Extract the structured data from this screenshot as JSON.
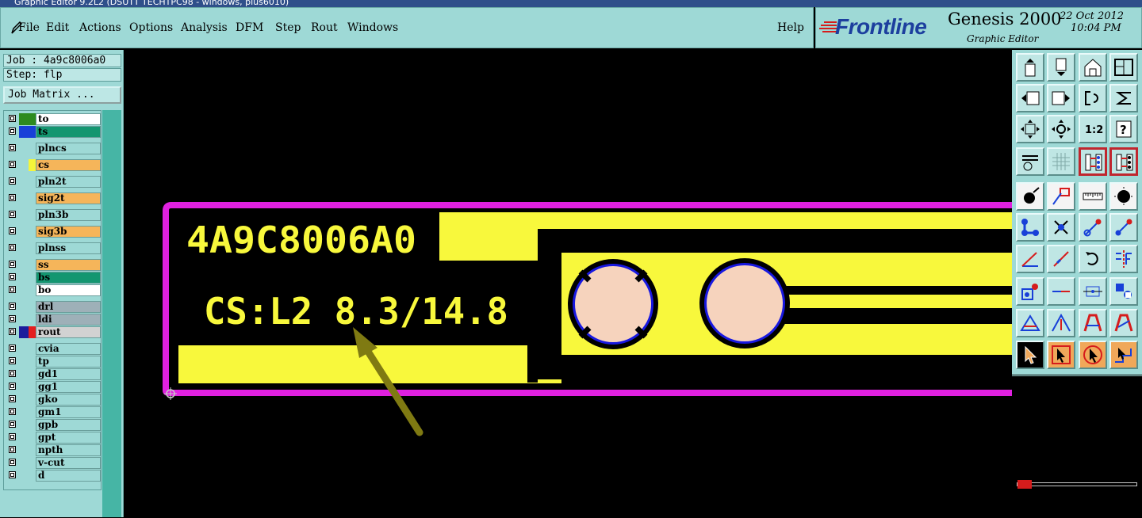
{
  "title_bar": "Graphic Editor 9.2L2 (DSUTT TECHTPC98 - windows, plus6010)",
  "menu": {
    "items": [
      {
        "label": "File"
      },
      {
        "label": "Edit"
      },
      {
        "label": "Actions"
      },
      {
        "label": "Options"
      },
      {
        "label": "Analysis"
      },
      {
        "label": "DFM"
      },
      {
        "label": "Step"
      },
      {
        "label": "Rout"
      },
      {
        "label": "Windows"
      }
    ],
    "help": "Help"
  },
  "brand": {
    "logo": "Frontline",
    "product": "Genesis 2000",
    "subtitle": "Graphic Editor",
    "date": "22 Oct 2012",
    "time": "10:04 PM"
  },
  "info": {
    "job": "Job : 4a9c8006a0",
    "step": "Step: flp",
    "job_matrix": "Job Matrix ..."
  },
  "layers": [
    {
      "name": "to",
      "sw1": "#2e8b1f",
      "sw2": "#2e8b1f",
      "bg": "#ffffff"
    },
    {
      "name": "ts",
      "sw1": "#1840d8",
      "sw2": "#1840d8",
      "bg": "#139670"
    },
    {
      "name": "plncs",
      "sw1": "#9ed9d6",
      "sw2": "#9ed9d6",
      "bg": "#9ed9d6"
    },
    {
      "name": "cs",
      "sw1": "#9ed9d6",
      "sw2": "#f5f53a",
      "bg": "#f5b55a"
    },
    {
      "name": "pln2t",
      "sw1": "#9ed9d6",
      "sw2": "#9ed9d6",
      "bg": "#9ed9d6"
    },
    {
      "name": "sig2t",
      "sw1": "#9ed9d6",
      "sw2": "#9ed9d6",
      "bg": "#f5b55a"
    },
    {
      "name": "pln3b",
      "sw1": "#9ed9d6",
      "sw2": "#9ed9d6",
      "bg": "#9ed9d6"
    },
    {
      "name": "sig3b",
      "sw1": "#9ed9d6",
      "sw2": "#9ed9d6",
      "bg": "#f5b55a"
    },
    {
      "name": "plnss",
      "sw1": "#9ed9d6",
      "sw2": "#9ed9d6",
      "bg": "#9ed9d6"
    },
    {
      "name": "ss",
      "sw1": "#9ed9d6",
      "sw2": "#9ed9d6",
      "bg": "#f5b55a"
    },
    {
      "name": "bs",
      "sw1": "#9ed9d6",
      "sw2": "#9ed9d6",
      "bg": "#139670"
    },
    {
      "name": "bo",
      "sw1": "#9ed9d6",
      "sw2": "#9ed9d6",
      "bg": "#ffffff"
    },
    {
      "name": "drl",
      "sw1": "#9ed9d6",
      "sw2": "#9ed9d6",
      "bg": "#9eb0b8"
    },
    {
      "name": "ldi",
      "sw1": "#9ed9d6",
      "sw2": "#9ed9d6",
      "bg": "#9eb0b8"
    },
    {
      "name": "rout",
      "sw1": "#1c1c9c",
      "sw2": "#e41e1e",
      "bg": "#d2d2d2"
    },
    {
      "name": "cvia",
      "sw1": "#9ed9d6",
      "sw2": "#9ed9d6",
      "bg": "#9ed9d6"
    },
    {
      "name": "tp",
      "sw1": "#9ed9d6",
      "sw2": "#9ed9d6",
      "bg": "#9ed9d6"
    },
    {
      "name": "gd1",
      "sw1": "#9ed9d6",
      "sw2": "#9ed9d6",
      "bg": "#9ed9d6"
    },
    {
      "name": "gg1",
      "sw1": "#9ed9d6",
      "sw2": "#9ed9d6",
      "bg": "#9ed9d6"
    },
    {
      "name": "gko",
      "sw1": "#9ed9d6",
      "sw2": "#9ed9d6",
      "bg": "#9ed9d6"
    },
    {
      "name": "gm1",
      "sw1": "#9ed9d6",
      "sw2": "#9ed9d6",
      "bg": "#9ed9d6"
    },
    {
      "name": "gpb",
      "sw1": "#9ed9d6",
      "sw2": "#9ed9d6",
      "bg": "#9ed9d6"
    },
    {
      "name": "gpt",
      "sw1": "#9ed9d6",
      "sw2": "#9ed9d6",
      "bg": "#9ed9d6"
    },
    {
      "name": "npth",
      "sw1": "#9ed9d6",
      "sw2": "#9ed9d6",
      "bg": "#9ed9d6"
    },
    {
      "name": "v-cut",
      "sw1": "#9ed9d6",
      "sw2": "#9ed9d6",
      "bg": "#9ed9d6"
    },
    {
      "name": "d",
      "sw1": "#9ed9d6",
      "sw2": "#9ed9d6",
      "bg": "#9ed9d6"
    }
  ],
  "canvas": {
    "board_text_1": "4A9C8006A0",
    "board_text_2": "CS:L2 8.3/14.8",
    "colors": {
      "background": "#000000",
      "outline": "#e021e0",
      "copper": "#f8f83c",
      "pad": "#f6d3bd",
      "pad_ring": "#1818e0",
      "arrow": "#7f7a12"
    }
  },
  "toolbox": [
    "page-up-icon",
    "page-down-icon",
    "home-view-icon",
    "window-icon",
    "page-left-icon",
    "page-right-icon",
    "undo-view-icon",
    "redo-view-icon",
    "zoom-fit-icon",
    "zoom-center-icon",
    "scale-1-2-icon",
    "help-icon",
    "measure-tool-icon",
    "grid-icon",
    "layer-stack-red-icon",
    "layer-stack-red-2-icon",
    "add-pad-icon",
    "select-shape-icon",
    "ruler-icon",
    "pad-center-icon",
    "connect-nodes-icon",
    "cross-select-icon",
    "line-red-icon",
    "line-red-2-icon",
    "angle-tool-icon",
    "diagonal-line-icon",
    "rotate-icon",
    "mirror-icon",
    "pad-offset-icon",
    "horizontal-line-icon",
    "snap-box-icon",
    "cluster-icon",
    "triangle-tool-icon",
    "arrow-triangle-icon",
    "arch-tool-icon",
    "arch-select-icon",
    "pointer-icon",
    "pointer-frame-icon",
    "pointer-target-icon",
    "pointer-step-icon"
  ]
}
